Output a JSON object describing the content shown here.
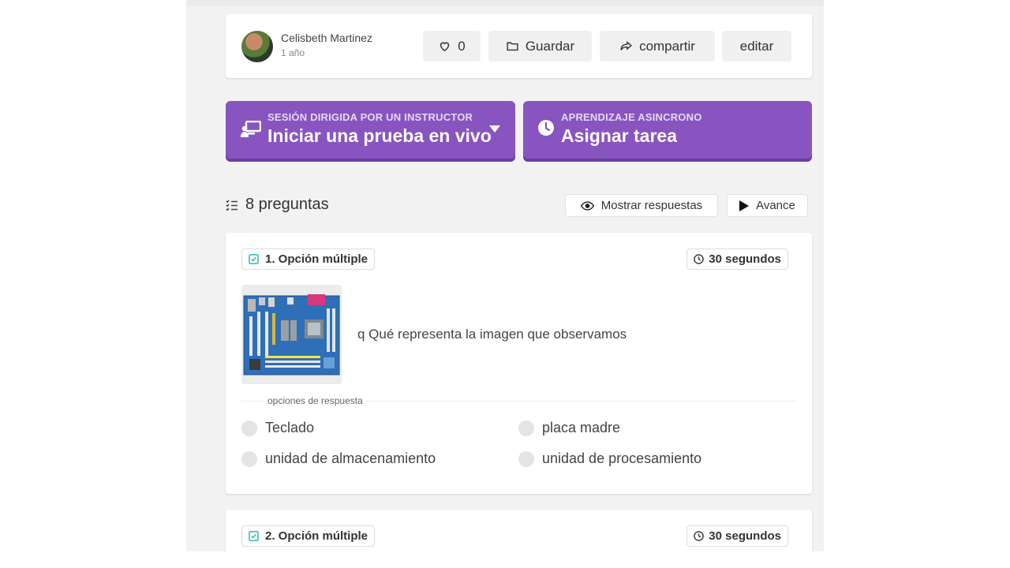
{
  "author": {
    "name": "Celisbeth Martinez",
    "time": "1 año"
  },
  "actions": {
    "likes": "0",
    "save": "Guardar",
    "share": "compartir",
    "edit": "editar"
  },
  "cta": {
    "live_kicker": "SESIÓN DIRIGIDA POR UN INSTRUCTOR",
    "live_label": "Iniciar una prueba en vivo",
    "async_kicker": "APRENDIZAJE ASINCRONO",
    "async_label": "Asignar tarea"
  },
  "questions_header": {
    "count_label": "8 preguntas",
    "show_answers": "Mostrar respuestas",
    "preview": "Avance"
  },
  "questions": [
    {
      "type": "1. Opción múltiple",
      "time": "30 segundos",
      "text": "q Qué representa la imagen que observamos",
      "options_label": "opciones de respuesta",
      "options": [
        "Teclado",
        "placa madre",
        "unidad de almacenamiento",
        "unidad de procesamiento"
      ]
    },
    {
      "type": "2. Opción múltiple",
      "time": "30 segundos"
    }
  ],
  "colors": {
    "accent": "#8854c0",
    "accent_shadow": "#6c3f9f",
    "page_bg": "#f2f2f2",
    "check_teal": "#2fb9b0"
  }
}
